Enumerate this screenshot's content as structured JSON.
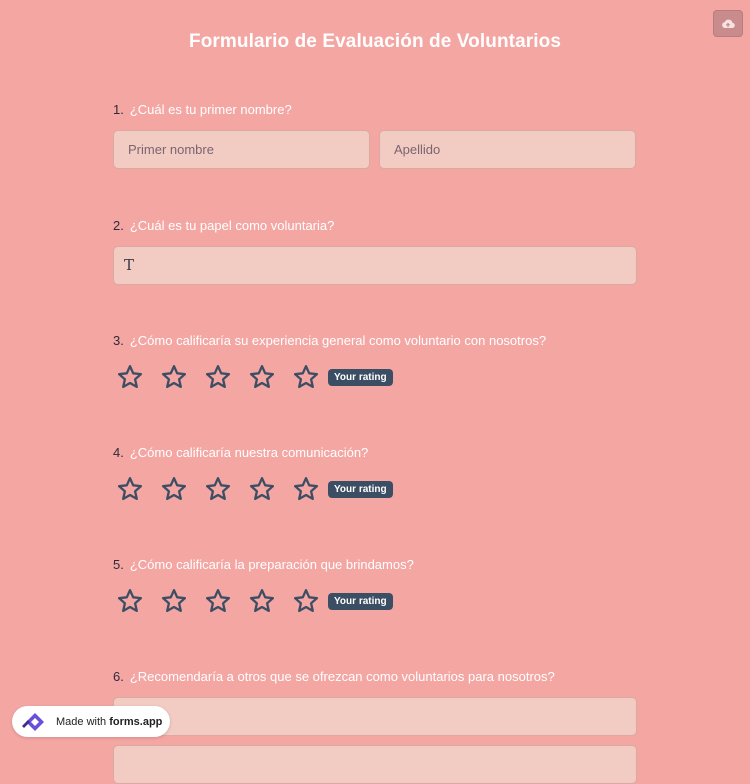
{
  "header": {
    "title": "Formulario de Evaluación de Voluntarios",
    "save_icon": "cloud-upload-icon"
  },
  "questions": {
    "q1": {
      "number": "1.",
      "label": "¿Cuál es tu primer nombre?",
      "first_placeholder": "Primer nombre",
      "last_placeholder": "Apellido"
    },
    "q2": {
      "number": "2.",
      "label": "¿Cuál es tu papel como voluntaria?",
      "icon": "text-icon",
      "icon_glyph": "T"
    },
    "q3": {
      "number": "3.",
      "label": "¿Cómo calificaría su experiencia general como voluntario con nosotros?",
      "rating_label": "Your rating",
      "max_stars": 5,
      "value": 0
    },
    "q4": {
      "number": "4.",
      "label": "¿Cómo calificaría nuestra comunicación?",
      "rating_label": "Your rating",
      "max_stars": 5,
      "value": 0
    },
    "q5": {
      "number": "5.",
      "label": "¿Cómo calificaría la preparación que brindamos?",
      "rating_label": "Your rating",
      "max_stars": 5,
      "value": 0
    },
    "q6": {
      "number": "6.",
      "label": "¿Recomendaría a otros que se ofrezcan como voluntarios para nosotros?"
    }
  },
  "footer": {
    "made_with": "Made with",
    "brand": "forms.app",
    "logo_icon": "forms-app-logo-icon"
  },
  "colors": {
    "background": "#f4a6a3",
    "field": "#f2cbc2",
    "star_stroke": "#3b4e63",
    "badge": "#3b4e63"
  }
}
